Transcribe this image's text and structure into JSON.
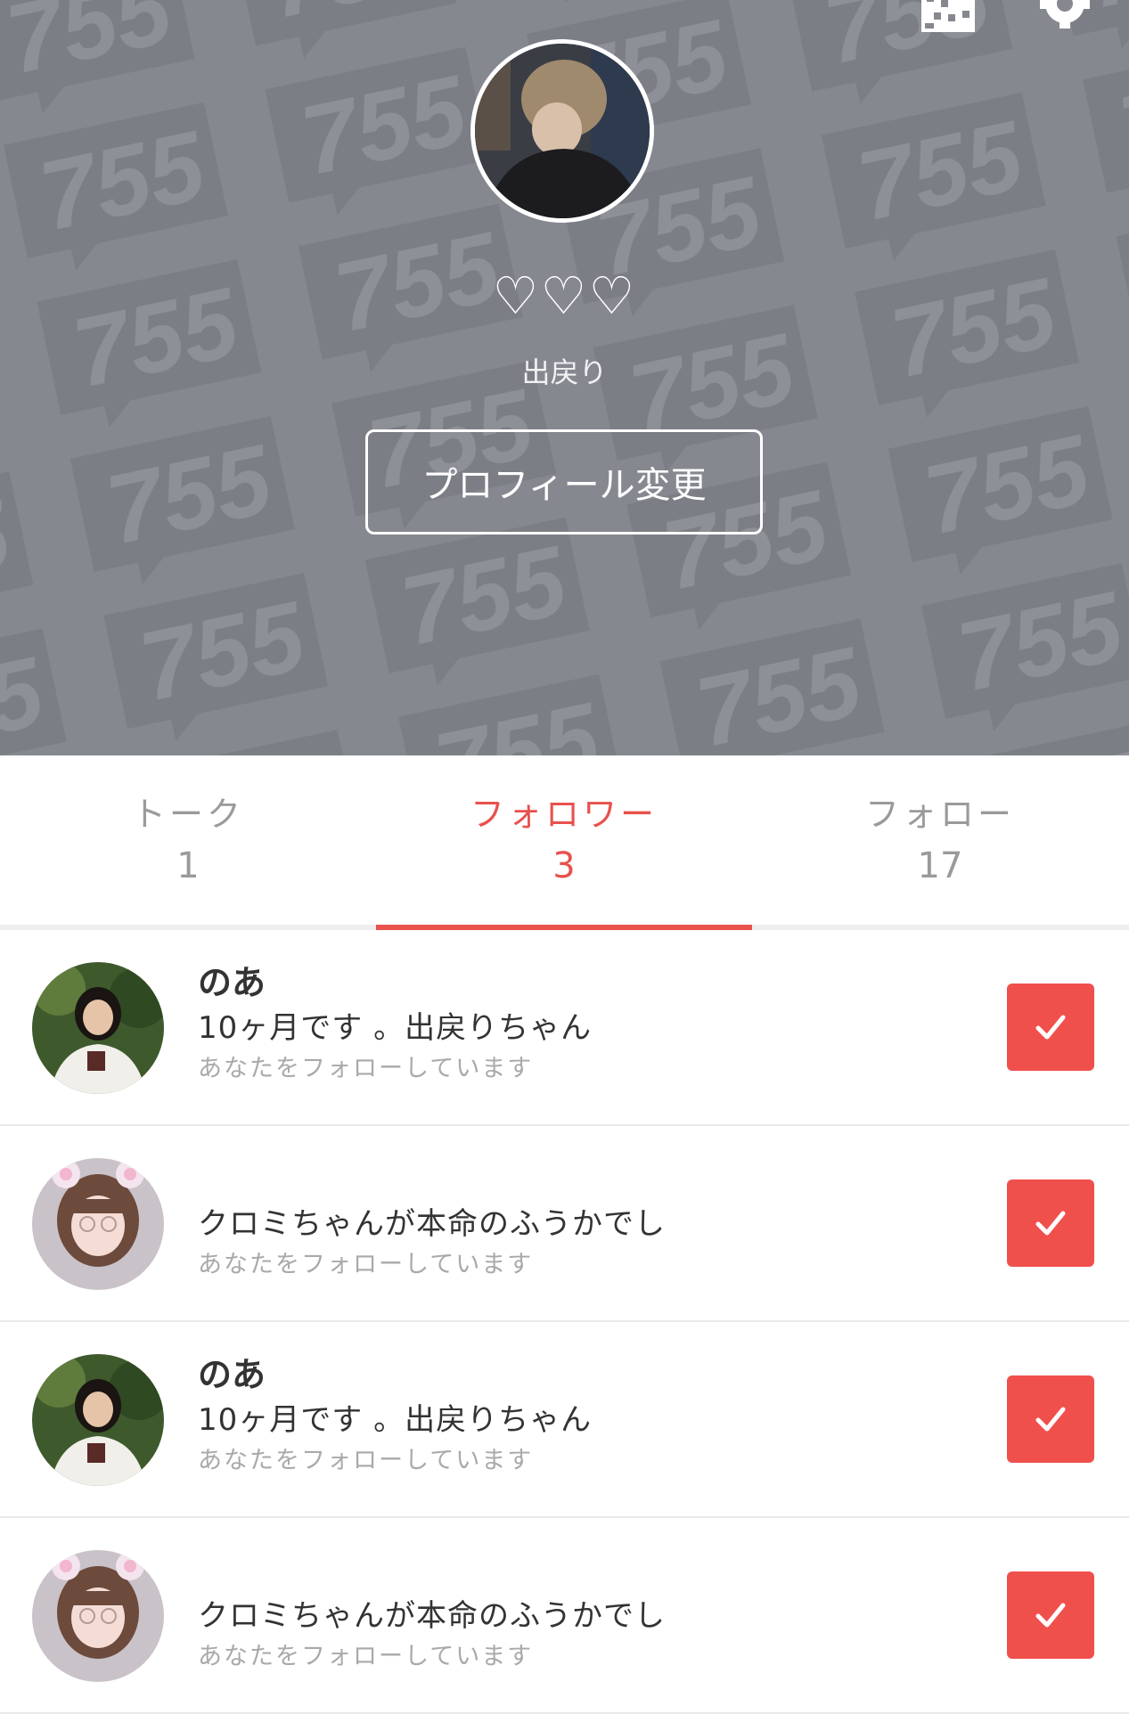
{
  "profile": {
    "hearts": "♡♡♡",
    "status": "出戻り",
    "edit_button": "プロフィール変更",
    "pattern_text": "755"
  },
  "tabs": [
    {
      "label": "トーク",
      "count": "1",
      "active": false
    },
    {
      "label": "フォロワー",
      "count": "3",
      "active": true
    },
    {
      "label": "フォロー",
      "count": "17",
      "active": false
    }
  ],
  "followers": [
    {
      "name": "のあ",
      "bio": "10ヶ月です 。出戻りちゃん",
      "follow_status": "あなたをフォローしています",
      "avatar": "girl-photo-avatar"
    },
    {
      "name": "",
      "bio": "クロミちゃんが本命のふうかでし",
      "follow_status": "あなたをフォローしています",
      "avatar": "girl-filter-avatar"
    },
    {
      "name": "のあ",
      "bio": "10ヶ月です 。出戻りちゃん",
      "follow_status": "あなたをフォローしています",
      "avatar": "girl-photo-avatar"
    },
    {
      "name": "",
      "bio": "クロミちゃんが本命のふうかでし",
      "follow_status": "あなたをフォローしています",
      "avatar": "girl-filter-avatar"
    }
  ],
  "colors": {
    "accent": "#e8514c",
    "header_bg": "#868890",
    "check_button": "#f0504c"
  },
  "icons": {
    "qr": "qr-code-icon",
    "settings": "gear-icon",
    "check": "check-icon"
  }
}
